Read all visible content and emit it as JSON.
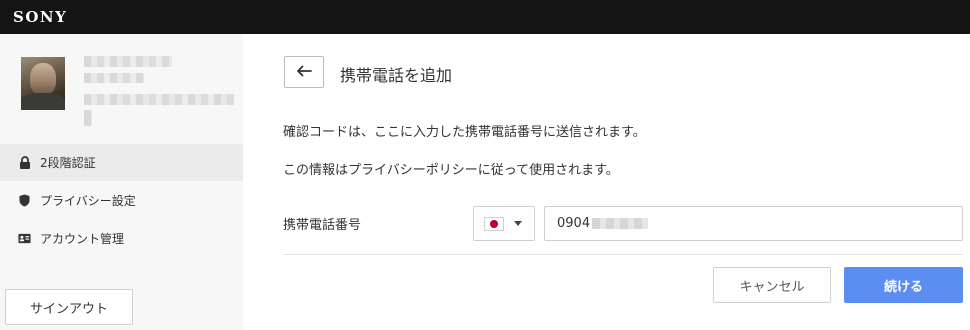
{
  "header": {
    "brand": "SONY"
  },
  "sidebar": {
    "items": [
      {
        "label": "2段階認証",
        "icon": "lock-icon",
        "active": true
      },
      {
        "label": "プライバシー設定",
        "icon": "shield-icon",
        "active": false
      },
      {
        "label": "アカウント管理",
        "icon": "id-card-icon",
        "active": false
      }
    ],
    "signout_label": "サインアウト"
  },
  "main": {
    "title": "携帯電話を追加",
    "info_line1": "確認コードは、ここに入力した携帯電話番号に送信されます。",
    "info_line2": "この情報はプライバシーポリシーに従って使用されます。",
    "phone_label": "携帯電話番号",
    "country": "JP",
    "phone_value": "0904",
    "cancel_label": "キャンセル",
    "continue_label": "続ける"
  },
  "colors": {
    "topbar": "#141414",
    "accent": "#5c8df0",
    "flag_red": "#bc002d"
  }
}
